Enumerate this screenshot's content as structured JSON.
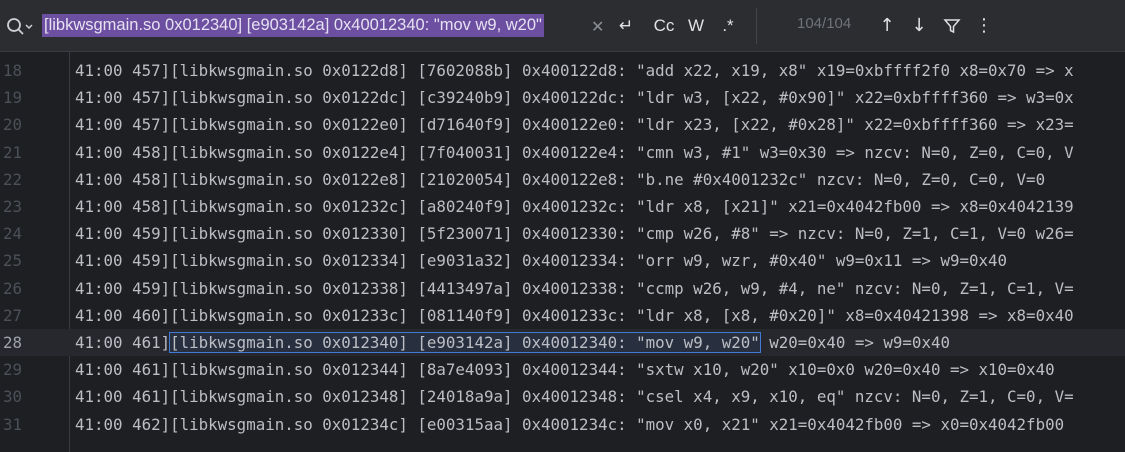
{
  "search": {
    "query": "[libkwsgmain.so 0x012340] [e903142a] 0x40012340: \"mov w9, w20\"",
    "match_counter": "104/104",
    "tools": {
      "newline_symbol": "↵",
      "match_case": "Cc",
      "whole_words": "W",
      "regex": ".*"
    },
    "icons": [
      "search-icon",
      "clear-icon",
      "newline-icon",
      "up-arrow-icon",
      "down-arrow-icon",
      "filter-icon",
      "more-icon"
    ]
  },
  "editor": {
    "current_line": 28,
    "lines": [
      {
        "no": "18",
        "pre": "41:00 457][libkwsgmain.so 0x0122d8] [7602088b] 0x400122d8: \"add x22, x19, x8\" x19=0xbffff2f0 x8=0x70 => x",
        "match": "",
        "post": ""
      },
      {
        "no": "19",
        "pre": "41:00 457][libkwsgmain.so 0x0122dc] [c39240b9] 0x400122dc: \"ldr w3, [x22, #0x90]\" x22=0xbffff360 => w3=0x",
        "match": "",
        "post": ""
      },
      {
        "no": "20",
        "pre": "41:00 457][libkwsgmain.so 0x0122e0] [d71640f9] 0x400122e0: \"ldr x23, [x22, #0x28]\" x22=0xbffff360 => x23=",
        "match": "",
        "post": ""
      },
      {
        "no": "21",
        "pre": "41:00 458][libkwsgmain.so 0x0122e4] [7f040031] 0x400122e4: \"cmn w3, #1\" w3=0x30 => nzcv: N=0, Z=0, C=0, V",
        "match": "",
        "post": ""
      },
      {
        "no": "22",
        "pre": "41:00 458][libkwsgmain.so 0x0122e8] [21020054] 0x400122e8: \"b.ne #0x4001232c\" nzcv: N=0, Z=0, C=0, V=0",
        "match": "",
        "post": ""
      },
      {
        "no": "23",
        "pre": "41:00 458][libkwsgmain.so 0x01232c] [a80240f9] 0x4001232c: \"ldr x8, [x21]\" x21=0x4042fb00 => x8=0x4042139",
        "match": "",
        "post": ""
      },
      {
        "no": "24",
        "pre": "41:00 459][libkwsgmain.so 0x012330] [5f230071] 0x40012330: \"cmp w26, #8\" => nzcv: N=0, Z=1, C=1, V=0 w26=",
        "match": "",
        "post": ""
      },
      {
        "no": "25",
        "pre": "41:00 459][libkwsgmain.so 0x012334] [e9031a32] 0x40012334: \"orr w9, wzr, #0x40\" w9=0x11 => w9=0x40",
        "match": "",
        "post": ""
      },
      {
        "no": "26",
        "pre": "41:00 459][libkwsgmain.so 0x012338] [4413497a] 0x40012338: \"ccmp w26, w9, #4, ne\" nzcv: N=0, Z=1, C=1, V=",
        "match": "",
        "post": ""
      },
      {
        "no": "27",
        "pre": "41:00 460][libkwsgmain.so 0x01233c] [081140f9] 0x4001233c: \"ldr x8, [x8, #0x20]\" x8=0x40421398 => x8=0x40",
        "match": "",
        "post": ""
      },
      {
        "no": "28",
        "pre": "41:00 461]",
        "match": "[libkwsgmain.so 0x012340] [e903142a] 0x40012340: \"mov w9, w20\"",
        "post": " w20=0x40 => w9=0x40"
      },
      {
        "no": "29",
        "pre": "41:00 461][libkwsgmain.so 0x012344] [8a7e4093] 0x40012344: \"sxtw x10, w20\" x10=0x0 w20=0x40 => x10=0x40",
        "match": "",
        "post": ""
      },
      {
        "no": "30",
        "pre": "41:00 461][libkwsgmain.so 0x012348] [24018a9a] 0x40012348: \"csel x4, x9, x10, eq\" nzcv: N=0, Z=1, C=0, V=",
        "match": "",
        "post": ""
      },
      {
        "no": "31",
        "pre": "41:00 462][libkwsgmain.so 0x01234c] [e00315aa] 0x4001234c: \"mov x0, x21\" x21=0x4042fb00 => x0=0x4042fb00",
        "match": "",
        "post": ""
      }
    ]
  },
  "colors": {
    "background": "#1e1f22",
    "search_highlight": "#6c4fa0",
    "match_outline": "#3f7ad6",
    "current_line": "#26282e"
  }
}
